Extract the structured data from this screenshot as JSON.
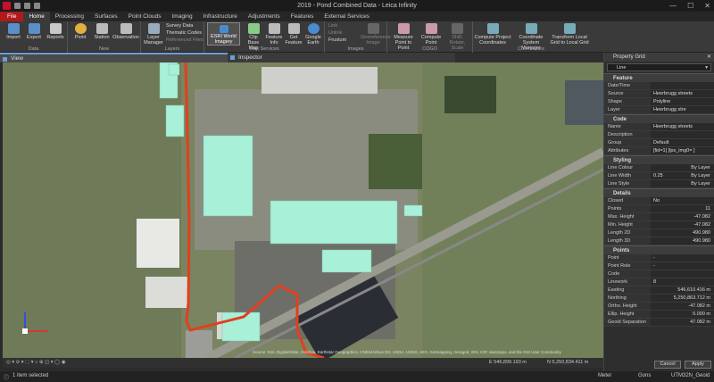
{
  "window": {
    "title": "2019 - Pond Combined Data - Leica Infinity",
    "min": "—",
    "max": "☐",
    "close": "✕"
  },
  "tabs": [
    "File",
    "Home",
    "Processing",
    "Surfaces",
    "Point Clouds",
    "Imaging",
    "Infrastructure",
    "Adjustments",
    "Features",
    "External Services"
  ],
  "ribbon": {
    "data": {
      "label": "Data",
      "import": "Import",
      "export": "Export",
      "reports": "Reports"
    },
    "new": {
      "label": "New",
      "point": "Point",
      "station": "Station",
      "observation": "Observation"
    },
    "layers": {
      "label": "Layers",
      "layer_manager": "Layer Manager",
      "survey_data": "Survey Data",
      "thematic_codes": "Thematic Codes",
      "referenced_files": "Referenced Files"
    },
    "map_services": {
      "label": "Map Services",
      "esri": "ESRI World Imagery",
      "clip": "Clip Base Map",
      "feature_info": "Feature Info",
      "get_feature": "Get Feature",
      "google": "Google Earth"
    },
    "images": {
      "label": "Images",
      "link": "Link",
      "unlink": "Unlink",
      "frustum": "Frustum",
      "georef": "Georeference Image"
    },
    "cogo": {
      "label": "COGO",
      "measure": "Measure Point to Point",
      "compute": "Compute Point",
      "shift": "Shift, Rotate, Scale"
    },
    "coordinates": {
      "label": "Coordinates",
      "compute_proj": "Compute Project Coordinates",
      "coord_sys": "Coordinate System Manager",
      "transform": "Transform Local Grid to Local Grid"
    }
  },
  "view_tabs": {
    "view": "View",
    "inspector": "Inspector"
  },
  "map": {
    "attribution": "Source: Esri, DigitalGlobe, GeoEye, Earthstar Geographics, CNES/Airbus DS, USDA, USGS, AEX, Getmapping, Aerogrid, IGN, IGP, swisstopo, and the GIS User Community",
    "easting": "E 546,899.193 m",
    "northing": "N 5,250,834.411 m"
  },
  "status": {
    "selected": "1 item selected",
    "units": "Meter",
    "angle": "Gons",
    "coord_sys": "UTM32N_Geoid"
  },
  "property_grid": {
    "title": "Property Grid",
    "selected": "Line",
    "feature": {
      "title": "Feature",
      "rows": [
        [
          "Date/Time",
          ""
        ],
        [
          "Source",
          "Heerbrugg streets"
        ],
        [
          "Shape",
          "Polyline"
        ],
        [
          "Layer",
          "Heerbrugg stre"
        ]
      ]
    },
    "code": {
      "title": "Code",
      "rows": [
        [
          "Name",
          "Heerbrugg streets"
        ],
        [
          "Description",
          ""
        ],
        [
          "Group",
          "Default"
        ],
        [
          "Attributes",
          "[fid=1] [lps_img0= ]"
        ]
      ]
    },
    "styling": {
      "title": "Styling",
      "rows": [
        [
          "Line Colour",
          "By Layer"
        ],
        [
          "Line Width",
          "0.25"
        ],
        [
          "Line Style",
          "By Layer"
        ]
      ],
      "width_suffix": "By Layer"
    },
    "details": {
      "title": "Details",
      "rows": [
        [
          "Closed",
          "No"
        ],
        [
          "Points",
          "11"
        ],
        [
          "Max. Height",
          "-47.082"
        ],
        [
          "Min. Height",
          "-47.082"
        ],
        [
          "Length 2D",
          "490.980"
        ],
        [
          "Length 3D",
          "490.980"
        ]
      ]
    },
    "points": {
      "title": "Points",
      "rows": [
        [
          "Point",
          "-"
        ],
        [
          "Point Role",
          "-"
        ],
        [
          "Code",
          ""
        ],
        [
          "Linework",
          "8"
        ],
        [
          "Easting",
          "546,610.416 m"
        ],
        [
          "Northing",
          "5,250,863.712 m"
        ],
        [
          "Ortho. Height",
          "-47.082 m"
        ],
        [
          "Ellip. Height",
          "0.000 m"
        ],
        [
          "Geoid Separation",
          "47.082 m"
        ]
      ]
    },
    "cancel": "Cancel",
    "apply": "Apply"
  },
  "colors": {
    "accent": "#6a9ed6",
    "file_tab": "#b11a1a",
    "road_line": "#e04020",
    "building": "#a8f0d8"
  }
}
